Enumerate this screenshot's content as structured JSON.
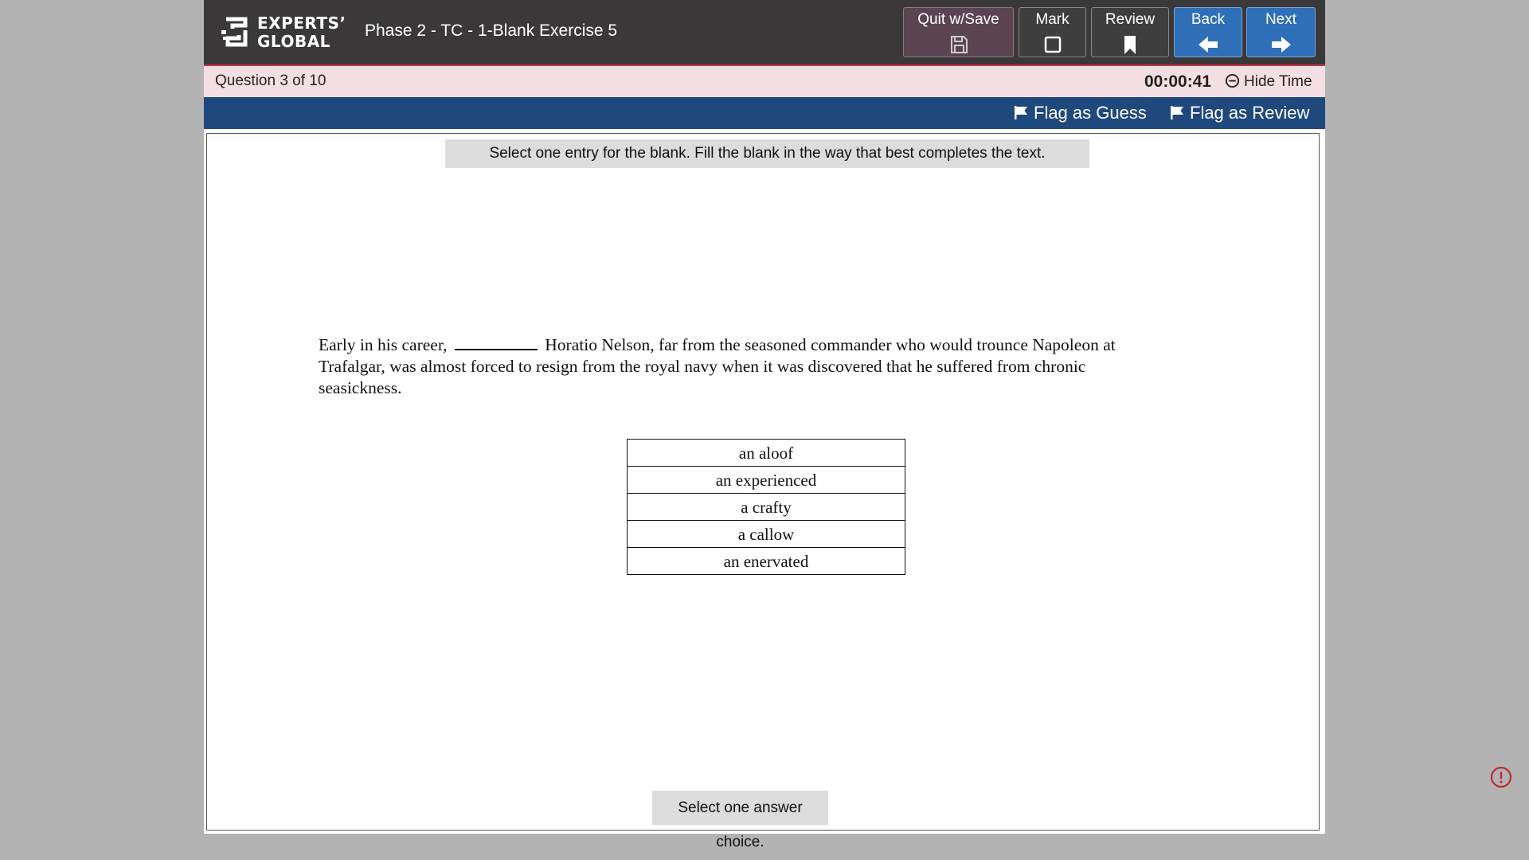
{
  "logo": {
    "line1": "EXPERTS’",
    "line2": "GLOBAL"
  },
  "header": {
    "title": "Phase 2 - TC - 1-Blank Exercise 5"
  },
  "toolbar": {
    "quit_label": "Quit w/Save",
    "mark_label": "Mark",
    "review_label": "Review",
    "back_label": "Back",
    "next_label": "Next",
    "quit_icon": "save-icon",
    "mark_icon": "checkbox-icon",
    "review_icon": "bookmark-icon",
    "back_icon": "arrow-left-icon",
    "next_icon": "arrow-right-icon"
  },
  "status": {
    "question_counter": "Question 3 of 10",
    "timer": "00:00:41",
    "hide_time_label": "Hide Time"
  },
  "flags": {
    "guess_label": "Flag as Guess",
    "review_label": "Flag as Review"
  },
  "question": {
    "instruction": "Select one entry for the blank. Fill the blank in the way that best completes the text.",
    "passage_before": "Early in his career,",
    "passage_after": "Horatio Nelson, far from the seasoned commander who would trounce Napoleon at Trafalgar, was almost forced to resign from the royal navy when it was discovered that he suffered from chronic seasickness.",
    "choices": [
      "an aloof",
      "an experienced",
      "a crafty",
      "a callow",
      "an enervated"
    ],
    "bottom_note": "Select one answer choice."
  },
  "colors": {
    "header_bg": "#3a3838",
    "status_bg": "#f3dfe3",
    "flag_bar_bg": "#1f497d",
    "nav_button_bg": "#2f6fb8",
    "alert": "#c0282d"
  }
}
